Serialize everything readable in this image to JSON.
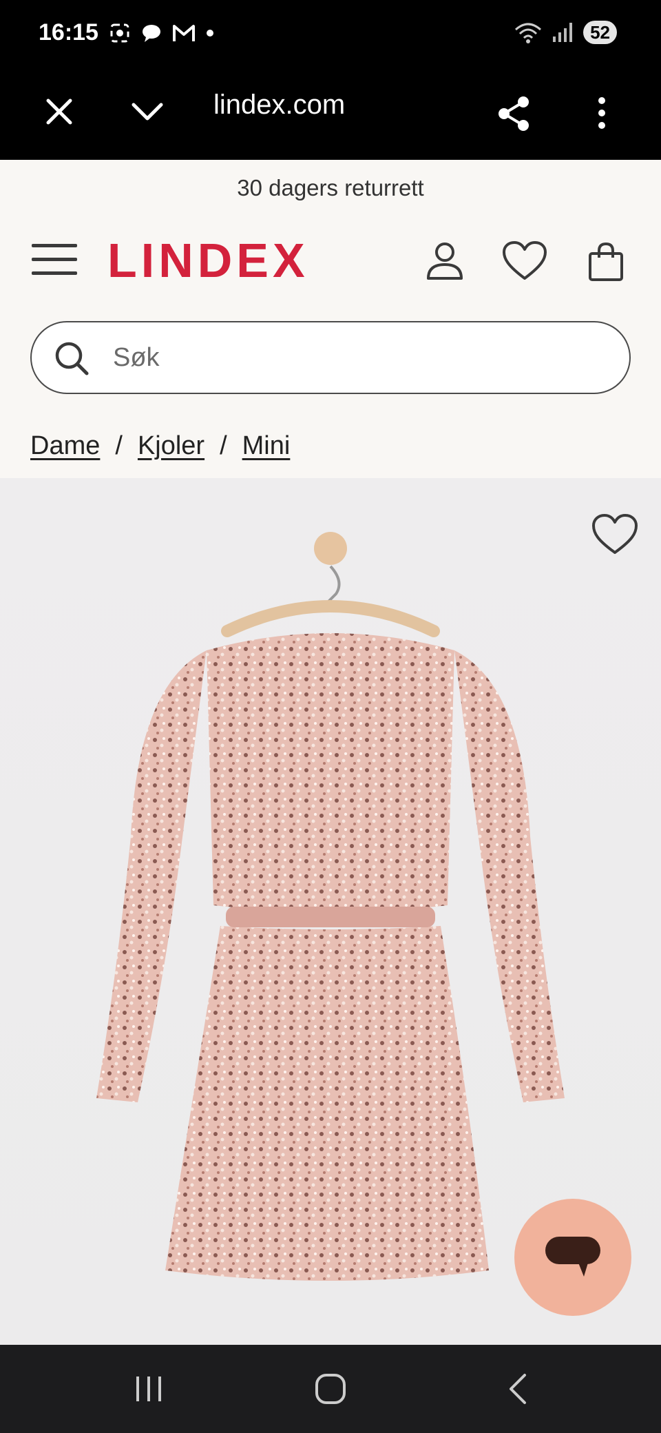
{
  "status_bar": {
    "time": "16:15",
    "left_icons": [
      "screenshot-icon",
      "chat-icon",
      "gmail-icon",
      "dot-icon"
    ],
    "right_icons": [
      "wifi-icon",
      "signal-icon"
    ],
    "battery": "52"
  },
  "browser": {
    "url": "lindex.com",
    "icons": [
      "close-icon",
      "chevron-down-icon",
      "share-icon",
      "more-vert-icon"
    ]
  },
  "site": {
    "promo": "30 dagers returrett",
    "logo": "LINDEX",
    "brand_color": "#d3223c",
    "search_placeholder": "Søk",
    "breadcrumb": [
      "Dame",
      "Kjoler",
      "Mini"
    ],
    "breadcrumb_separator": "/"
  },
  "product": {
    "image": "pink sequin long-sleeve mini dress on wooden hanger, back view",
    "chat_color": "#f1b29b"
  }
}
